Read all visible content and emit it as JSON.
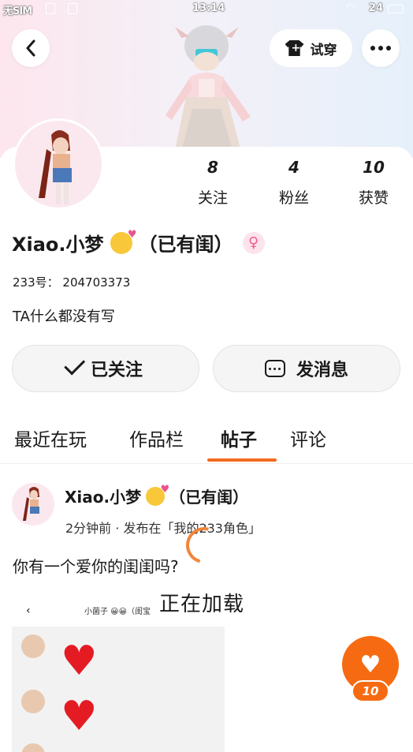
{
  "status_bar": {
    "carrier": "无SIM",
    "time": "13:14",
    "battery": "24"
  },
  "header": {
    "try_on_label": "试穿"
  },
  "profile": {
    "stats": [
      {
        "value": "8",
        "label": "关注"
      },
      {
        "value": "4",
        "label": "粉丝"
      },
      {
        "value": "10",
        "label": "获赞"
      }
    ],
    "username": "Xiao.小梦",
    "username_suffix": "（已有闺）",
    "gender_symbol": "♀",
    "uid": "233号： 204703373",
    "bio": "TA什么都没有写"
  },
  "actions": {
    "follow_label": "已关注",
    "message_label": "发消息"
  },
  "tabs": [
    {
      "label": "最近在玩",
      "active": false
    },
    {
      "label": "作品栏",
      "active": false
    },
    {
      "label": "帖子",
      "active": true
    },
    {
      "label": "评论",
      "active": false
    }
  ],
  "post": {
    "author": "Xiao.小梦",
    "author_suffix": "（已有闺）",
    "meta": "2分钟前 · 发布在「我的233角色」",
    "text": "你有一个爱你的闺闺吗?",
    "image_header_title": "小菌子 😀😀（闺宝"
  },
  "loading_text": "正在加载",
  "like": {
    "count": "10"
  },
  "colors": {
    "accent": "#f66b12",
    "tab_indicator": "#f26b1d"
  }
}
